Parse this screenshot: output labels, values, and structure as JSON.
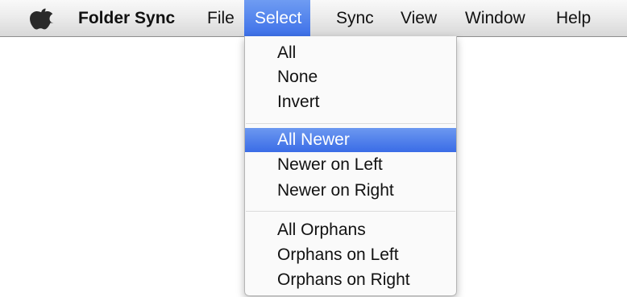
{
  "menubar": {
    "apple_icon": "apple-logo-icon",
    "app_name": "Folder Sync",
    "menus": [
      "File",
      "Select",
      "Sync",
      "View",
      "Window",
      "Help"
    ],
    "active_menu": "Select"
  },
  "select_menu": {
    "groups": [
      [
        "All",
        "None",
        "Invert"
      ],
      [
        "All Newer",
        "Newer on Left",
        "Newer on Right"
      ],
      [
        "All Orphans",
        "Orphans on Left",
        "Orphans on Right"
      ]
    ],
    "highlighted_item": "All Newer"
  },
  "colors": {
    "highlight": "#3d70e8",
    "menubar": "#ececec"
  }
}
